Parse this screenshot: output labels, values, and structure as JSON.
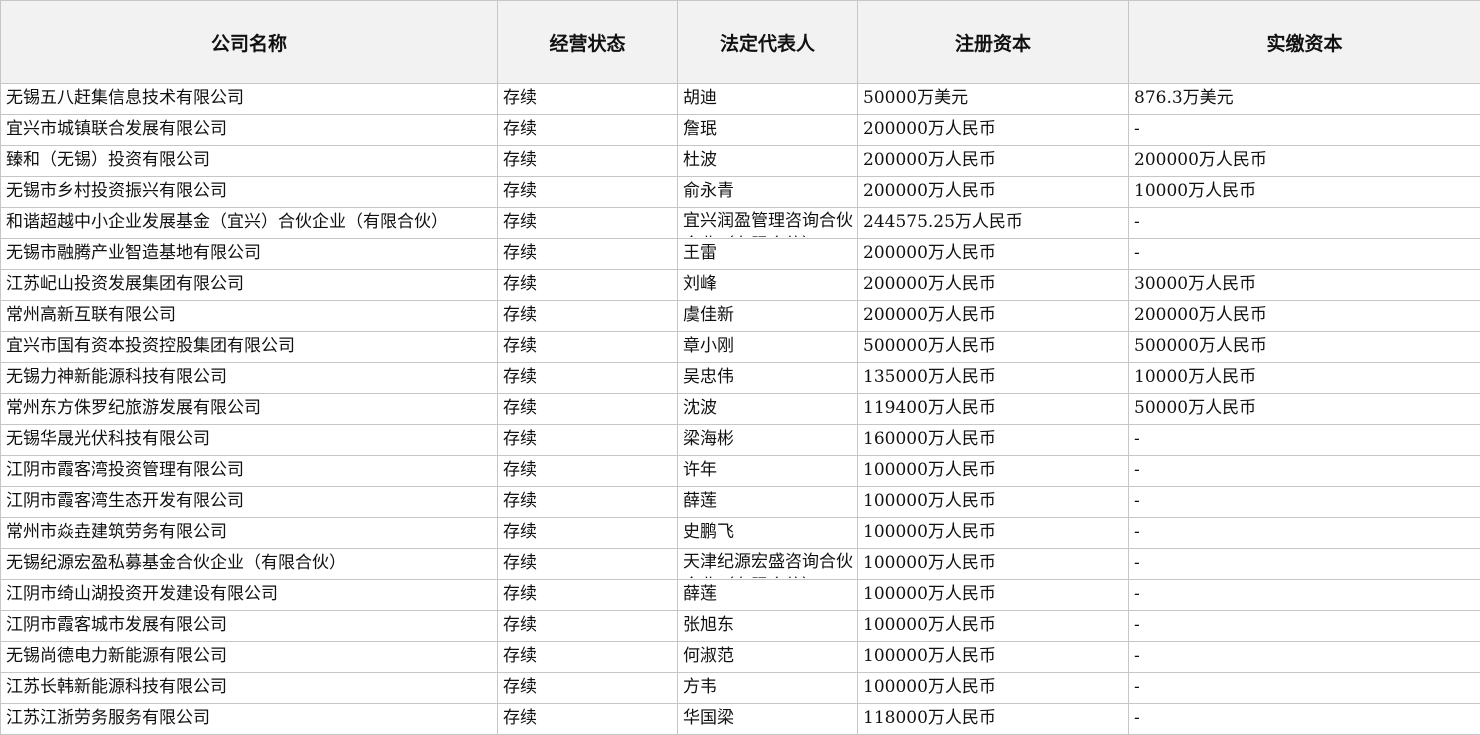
{
  "headers": [
    "公司名称",
    "经营状态",
    "法定代表人",
    "注册资本",
    "实缴资本"
  ],
  "rows": [
    [
      "无锡五八赶集信息技术有限公司",
      "存续",
      "胡迪",
      "50000万美元",
      "876.3万美元"
    ],
    [
      "宜兴市城镇联合发展有限公司",
      "存续",
      "詹珉",
      "200000万人民币",
      "-"
    ],
    [
      "臻和（无锡）投资有限公司",
      "存续",
      "杜波",
      "200000万人民币",
      "200000万人民币"
    ],
    [
      "无锡市乡村投资振兴有限公司",
      "存续",
      "俞永青",
      "200000万人民币",
      "10000万人民币"
    ],
    [
      "和谐超越中小企业发展基金（宜兴）合伙企业（有限合伙）",
      "存续",
      "宜兴润盈管理咨询合伙企业（有限合伙）",
      "244575.25万人民币",
      "-"
    ],
    [
      "无锡市融腾产业智造基地有限公司",
      "存续",
      "王雷",
      "200000万人民币",
      "-"
    ],
    [
      "江苏屺山投资发展集团有限公司",
      "存续",
      "刘峰",
      "200000万人民币",
      "30000万人民币"
    ],
    [
      "常州高新互联有限公司",
      "存续",
      "虞佳新",
      "200000万人民币",
      "200000万人民币"
    ],
    [
      "宜兴市国有资本投资控股集团有限公司",
      "存续",
      "章小刚",
      "500000万人民币",
      "500000万人民币"
    ],
    [
      "无锡力神新能源科技有限公司",
      "存续",
      "吴忠伟",
      "135000万人民币",
      "10000万人民币"
    ],
    [
      "常州东方侏罗纪旅游发展有限公司",
      "存续",
      "沈波",
      "119400万人民币",
      "50000万人民币"
    ],
    [
      "无锡华晟光伏科技有限公司",
      "存续",
      "梁海彬",
      "160000万人民币",
      "-"
    ],
    [
      "江阴市霞客湾投资管理有限公司",
      "存续",
      "许年",
      "100000万人民币",
      "-"
    ],
    [
      "江阴市霞客湾生态开发有限公司",
      "存续",
      "薛莲",
      "100000万人民币",
      "-"
    ],
    [
      "常州市焱垚建筑劳务有限公司",
      "存续",
      "史鹏飞",
      "100000万人民币",
      "-"
    ],
    [
      "无锡纪源宏盈私募基金合伙企业（有限合伙）",
      "存续",
      "天津纪源宏盛咨询合伙企业（有限合伙）",
      "100000万人民币",
      "-"
    ],
    [
      "江阴市绮山湖投资开发建设有限公司",
      "存续",
      "薛莲",
      "100000万人民币",
      "-"
    ],
    [
      "江阴市霞客城市发展有限公司",
      "存续",
      "张旭东",
      "100000万人民币",
      "-"
    ],
    [
      "无锡尚德电力新能源有限公司",
      "存续",
      "何淑范",
      "100000万人民币",
      "-"
    ],
    [
      "江苏长韩新能源科技有限公司",
      "存续",
      "方韦",
      "100000万人民币",
      "-"
    ],
    [
      "江苏江浙劳务服务有限公司",
      "存续",
      "华国梁",
      "118000万人民币",
      "-"
    ]
  ]
}
